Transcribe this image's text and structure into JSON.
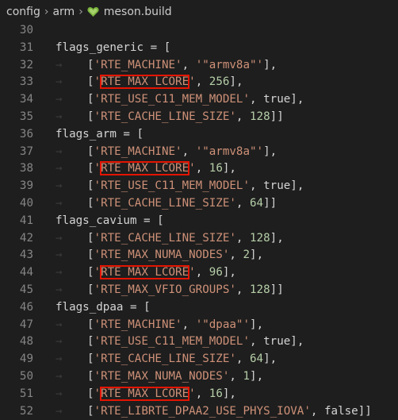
{
  "breadcrumb": {
    "items": [
      "config",
      "arm",
      "meson.build"
    ],
    "file_icon": "meson-heart-icon"
  },
  "colors": {
    "background": "#1e1e1e",
    "string": "#ce9178",
    "number": "#b5cea8",
    "highlight_box": "#e51400",
    "line_number": "#858585"
  },
  "lines": [
    {
      "n": "30",
      "text": ""
    },
    {
      "n": "31",
      "text": "flags_generic = ["
    },
    {
      "n": "32",
      "text": "['RTE_MACHINE', '\"armv8a\"'],"
    },
    {
      "n": "33",
      "text": "['RTE_MAX_LCORE', 256],"
    },
    {
      "n": "34",
      "text": "['RTE_USE_C11_MEM_MODEL', true],"
    },
    {
      "n": "35",
      "text": "['RTE_CACHE_LINE_SIZE', 128]]"
    },
    {
      "n": "36",
      "text": "flags_arm = ["
    },
    {
      "n": "37",
      "text": "['RTE_MACHINE', '\"armv8a\"'],"
    },
    {
      "n": "38",
      "text": "['RTE_MAX_LCORE', 16],"
    },
    {
      "n": "39",
      "text": "['RTE_USE_C11_MEM_MODEL', true],"
    },
    {
      "n": "40",
      "text": "['RTE_CACHE_LINE_SIZE', 64]]"
    },
    {
      "n": "41",
      "text": "flags_cavium = ["
    },
    {
      "n": "42",
      "text": "['RTE_CACHE_LINE_SIZE', 128],"
    },
    {
      "n": "43",
      "text": "['RTE_MAX_NUMA_NODES', 2],"
    },
    {
      "n": "44",
      "text": "['RTE_MAX_LCORE', 96],"
    },
    {
      "n": "45",
      "text": "['RTE_MAX_VFIO_GROUPS', 128]]"
    },
    {
      "n": "46",
      "text": "flags_dpaa = ["
    },
    {
      "n": "47",
      "text": "['RTE_MACHINE', '\"dpaa\"'],"
    },
    {
      "n": "48",
      "text": "['RTE_USE_C11_MEM_MODEL', true],"
    },
    {
      "n": "49",
      "text": "['RTE_CACHE_LINE_SIZE', 64],"
    },
    {
      "n": "50",
      "text": "['RTE_MAX_NUMA_NODES', 1],"
    },
    {
      "n": "51",
      "text": "['RTE_MAX_LCORE', 16],"
    },
    {
      "n": "52",
      "text": "['RTE_LIBRTE_DPAA2_USE_PHYS_IOVA', false]]"
    }
  ]
}
